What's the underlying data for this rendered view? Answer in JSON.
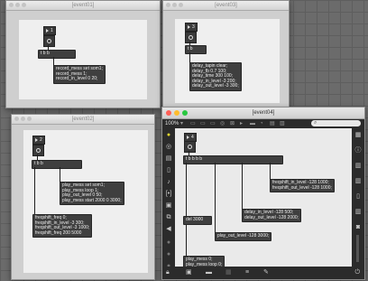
{
  "windows": {
    "event01": {
      "title": "[event01]",
      "msg": "1",
      "trigger": "t b b",
      "comment": "record_mess set som1;\nrecord_mess 1;\nrecord_in_level 0 20;"
    },
    "event03": {
      "title": "[event03]",
      "msg": "3",
      "trigger": "t b",
      "comment": "delay_tapin clear;\ndelay_fb 0.7 100;\ndelay_time 300 100;\ndelay_in_level -3 200;\ndelay_out_level -3 300;"
    },
    "event02": {
      "title": "[event02]",
      "msg": "2",
      "trigger": "t b b",
      "comment_a": "play_mess set som1;\nplay_mess loop 1;\nplay_out_level 0 50;\nplay_mess start 2000 0 3000;",
      "comment_b": "freqshift_freq 0;\nfreqshift_in_level -3 300;\nfreqshift_out_level -3 1000;\nfreqshift_freq 200 5000"
    },
    "event04": {
      "title": "[event04]",
      "zoom": "100%",
      "msg": "4",
      "trigger": "t b b b b",
      "delay": "del 3000",
      "comment_a": "freqshift_in_level -128 1000;\nfreqshift_out_level -128 1000;",
      "comment_b": "delay_in_level -128 500;\ndelay_out_level -128 2000;",
      "comment_c": "play_out_level -128 3000;",
      "comment_d": "play_mess 0;\nplay_mess loop 0;",
      "search_icon": "search-icon"
    }
  }
}
